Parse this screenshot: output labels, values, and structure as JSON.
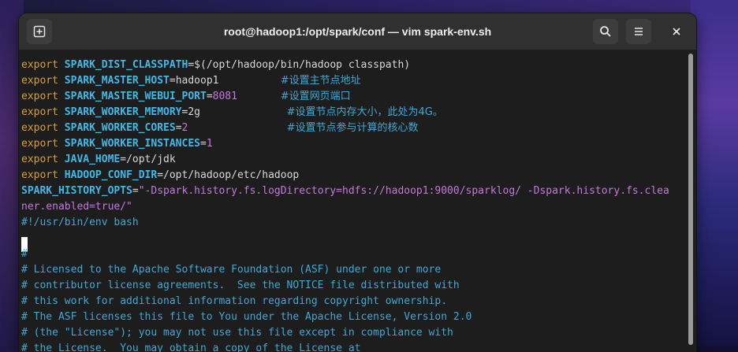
{
  "window": {
    "title": "root@hadoop1:/opt/spark/conf — vim spark-env.sh"
  },
  "toolbar": {
    "new_tab": "new-tab-icon",
    "search": "search-icon",
    "menu": "hamburger-menu-icon",
    "close": "close-icon"
  },
  "editor": {
    "lines": [
      {
        "kw": "export",
        "name": "SPARK_DIST_CLASSPATH",
        "eq": "=",
        "val": "$(/opt/hadoop/bin/hadoop classpath)",
        "pad": "",
        "cmt": ""
      },
      {
        "kw": "export",
        "name": "SPARK_MASTER_HOST",
        "eq": "=",
        "val": "hadoop1",
        "pad": "          ",
        "cmt": "#设置主节点地址"
      },
      {
        "kw": "export",
        "name": "SPARK_MASTER_WEBUI_PORT",
        "eq": "=",
        "val": "8081",
        "pad": "       ",
        "cmt": "#设置网页端口"
      },
      {
        "kw": "export",
        "name": "SPARK_WORKER_MEMORY",
        "eq": "=",
        "val": "2g",
        "pad": "              ",
        "cmt": "#设置节点内存大小，此处为4G。"
      },
      {
        "kw": "export",
        "name": "SPARK_WORKER_CORES",
        "eq": "=",
        "val": "2",
        "pad": "                ",
        "cmt": "#设置节点参与计算的核心数"
      },
      {
        "kw": "export",
        "name": "SPARK_WORKER_INSTANCES",
        "eq": "=",
        "val": "1",
        "pad": "",
        "cmt": ""
      },
      {
        "kw": "export",
        "name": "JAVA_HOME",
        "eq": "=",
        "val": "/opt/jdk",
        "pad": "",
        "cmt": ""
      },
      {
        "kw": "export",
        "name": "HADOOP_CONF_DIR",
        "eq": "=",
        "val": "/opt/hadoop/etc/hadoop",
        "pad": "",
        "cmt": ""
      }
    ],
    "history_name": "SPARK_HISTORY_OPTS",
    "history_eq": "=",
    "history_val_1": "\"-Dspark.history.fs.logDirectory=hdfs://hadoop1:9000/sparklog/ -Dspark.history.fs.clea",
    "history_val_2": "ner.enabled=true/\"",
    "shebang": "#!/usr/bin/env bash",
    "comments": [
      "#",
      "# Licensed to the Apache Software Foundation (ASF) under one or more",
      "# contributor license agreements.  See the NOTICE file distributed with",
      "# this work for additional information regarding copyright ownership.",
      "# The ASF licenses this file to You under the Apache License, Version 2.0",
      "# (the \"License\"); you may not use this file except in compliance with",
      "# the License.  You may obtain a copy of the License at"
    ]
  }
}
